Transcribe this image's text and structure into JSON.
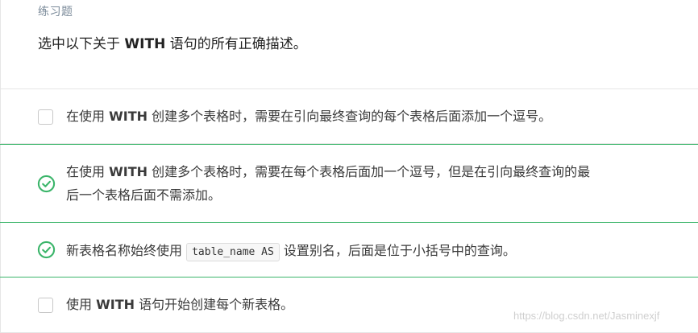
{
  "quiz": {
    "label": "练习题",
    "question_pre": "选中以下关于 ",
    "question_keyword": "WITH",
    "question_post": " 语句的所有正确描述。"
  },
  "options": [
    {
      "state": "unchecked",
      "pre": "在使用 ",
      "kw": "WITH",
      "post": " 创建多个表格时，需要在引向最终查询的每个表格后面添加一个逗号。"
    },
    {
      "state": "correct",
      "pre": "在使用 ",
      "kw": "WITH",
      "line1_post": " 创建多个表格时，需要在每个表格后面加一个逗号，但是在引向最终查询的最",
      "line2": "后一个表格后面不需添加。"
    },
    {
      "state": "correct",
      "pre": "新表格名称始终使用 ",
      "code": "table_name AS",
      "post": " 设置别名，后面是位于小括号中的查询。"
    },
    {
      "state": "unchecked",
      "pre": "使用 ",
      "kw": "WITH",
      "post": " 语句开始创建每个新表格。"
    }
  ],
  "watermark": "https://blog.csdn.net/Jasminexjf",
  "colors": {
    "correct": "#3bb56a",
    "border": "#e6e6e6",
    "label": "#7a8a99"
  }
}
